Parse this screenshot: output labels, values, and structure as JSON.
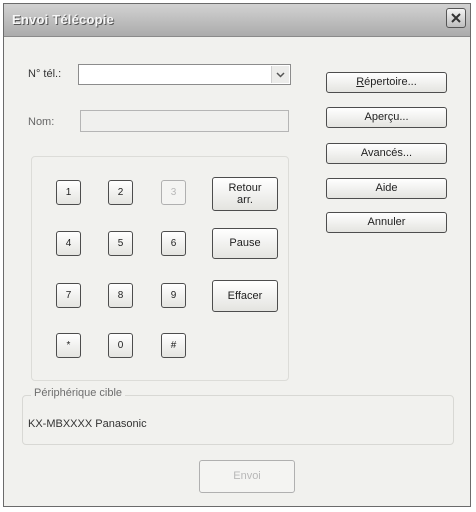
{
  "window": {
    "title": "Envoi  Télécopie",
    "close_icon": "close-icon"
  },
  "phone": {
    "label": "N° tél.:",
    "value": "",
    "dropdown_icon": "chevron-down-icon"
  },
  "name": {
    "label": "Nom:",
    "value": ""
  },
  "side_buttons": {
    "directory": "Répertoire...",
    "preview": "Aperçu...",
    "advanced": "Avancés...",
    "help": "Aide",
    "cancel": "Annuler"
  },
  "keypad": {
    "keys": [
      "1",
      "2",
      "3",
      "4",
      "5",
      "6",
      "7",
      "8",
      "9",
      "*",
      "0",
      "#"
    ],
    "back": "Retour arr.",
    "pause": "Pause",
    "clear": "Effacer"
  },
  "target_device": {
    "title": "Périphérique cible",
    "value": "KX-MBXXXX Panasonic"
  },
  "send_button": "Envoi"
}
